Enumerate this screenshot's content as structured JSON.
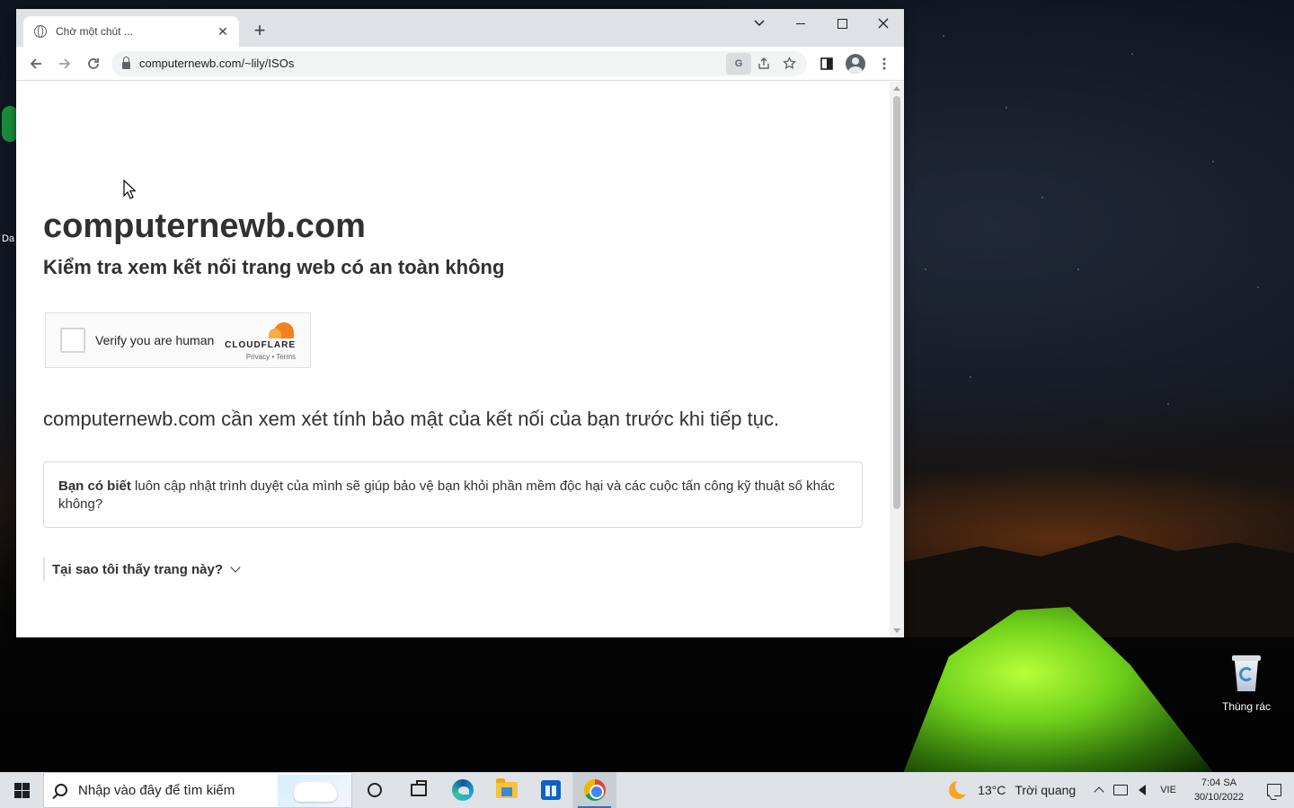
{
  "browser": {
    "tab_title": "Chờ một chút ...",
    "tab_close": "✕",
    "new_tab": "+",
    "url": "computernewb.com/~lily/ISOs",
    "translate_icon": "G"
  },
  "page": {
    "site_heading": "computernewb.com",
    "subheading": "Kiểm tra xem kết nối trang web có an toàn không",
    "turnstile": {
      "label": "Verify you are human",
      "brand": "CLOUDFLARE",
      "links": "Privacy • Terms"
    },
    "description": "computernewb.com cần xem xét tính bảo mật của kết nối của bạn trước khi tiếp tục.",
    "note_bold": "Bạn có biết",
    "note_text": " luôn cập nhật trình duyệt của mình sẽ giúp bảo vệ bạn khỏi phần mềm độc hại và các cuộc tấn công kỹ thuật số khác không?",
    "why_label": "Tại sao tôi thấy trang này?"
  },
  "desktop": {
    "recycle_bin": "Thùng rác",
    "left_fragment": "Da"
  },
  "taskbar": {
    "search_placeholder": "Nhập vào đây để tìm kiếm",
    "temperature": "13°C",
    "condition": "Trời quang",
    "language": "VIE",
    "time": "7:04 SA",
    "date": "30/10/2022"
  }
}
